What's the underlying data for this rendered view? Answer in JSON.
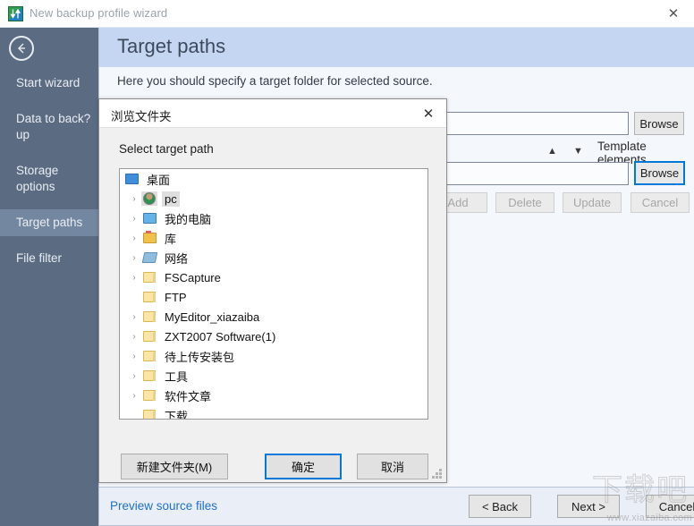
{
  "window": {
    "title": "New backup profile wizard",
    "app_icon": "backup-arrows-icon",
    "close_label": "✕"
  },
  "sidebar": {
    "back_icon": "back-arrow-icon",
    "items": [
      {
        "label": "Start wizard",
        "active": false
      },
      {
        "label": "Data to back?up",
        "active": false
      },
      {
        "label": "Storage options",
        "active": false
      },
      {
        "label": "Target paths",
        "active": true
      },
      {
        "label": "File filter",
        "active": false
      }
    ]
  },
  "page": {
    "title": "Target paths",
    "subtitle": "Here you should specify a target folder for selected source."
  },
  "form": {
    "path_field_1": {
      "value": "",
      "placeholder": ""
    },
    "path_field_2": {
      "value": "",
      "placeholder": ""
    },
    "browse_1_label": "Browse",
    "browse_2_label": "Browse",
    "move_up_icon": "arrow-up-icon",
    "move_down_icon": "arrow-down-icon",
    "template_label": "Template elements",
    "template_caret_icon": "chevron-down-icon",
    "actions": [
      {
        "label": "Add",
        "enabled": false
      },
      {
        "label": "Delete",
        "enabled": false
      },
      {
        "label": "Update",
        "enabled": false
      },
      {
        "label": "Cancel",
        "enabled": false
      }
    ]
  },
  "bottom": {
    "preview_link": "Preview source files",
    "back_label": "< Back",
    "next_label": "Next >",
    "cancel_label": "Cancel"
  },
  "dialog": {
    "title": "浏览文件夹",
    "close_label": "✕",
    "prompt": "Select target path",
    "tree": [
      {
        "label": "桌面",
        "icon": "monitor-icon",
        "indent": 0,
        "twisty": "",
        "selected": false
      },
      {
        "label": "pc",
        "icon": "user-icon",
        "indent": 1,
        "twisty": "›",
        "selected": true
      },
      {
        "label": "我的电脑",
        "icon": "computer-icon",
        "indent": 1,
        "twisty": "›",
        "selected": false
      },
      {
        "label": "库",
        "icon": "library-icon",
        "indent": 1,
        "twisty": "›",
        "selected": false
      },
      {
        "label": "网络",
        "icon": "network-icon",
        "indent": 1,
        "twisty": "›",
        "selected": false
      },
      {
        "label": "FSCapture",
        "icon": "folder-icon",
        "indent": 1,
        "twisty": "›",
        "selected": false
      },
      {
        "label": "FTP",
        "icon": "folder-icon",
        "indent": 1,
        "twisty": "",
        "selected": false
      },
      {
        "label": "MyEditor_xiazaiba",
        "icon": "folder-icon",
        "indent": 1,
        "twisty": "›",
        "selected": false
      },
      {
        "label": "ZXT2007 Software(1)",
        "icon": "folder-icon",
        "indent": 1,
        "twisty": "›",
        "selected": false
      },
      {
        "label": "待上传安装包",
        "icon": "folder-icon",
        "indent": 1,
        "twisty": "›",
        "selected": false
      },
      {
        "label": "工具",
        "icon": "folder-icon",
        "indent": 1,
        "twisty": "›",
        "selected": false
      },
      {
        "label": "软件文章",
        "icon": "folder-icon",
        "indent": 1,
        "twisty": "›",
        "selected": false
      },
      {
        "label": "下载",
        "icon": "folder-icon",
        "indent": 1,
        "twisty": "",
        "selected": false
      }
    ],
    "new_folder_label": "新建文件夹(M)",
    "ok_label": "确定",
    "cancel_label": "取消"
  },
  "watermark": {
    "url": "www.xiazaiba.com",
    "brand": "下载吧"
  },
  "colors": {
    "sidebar_bg": "#5b6b82",
    "sidebar_active": "#7487a0",
    "header_bg": "#c5d6f2",
    "accent_focus": "#0078d7",
    "link": "#1f6fd0"
  }
}
